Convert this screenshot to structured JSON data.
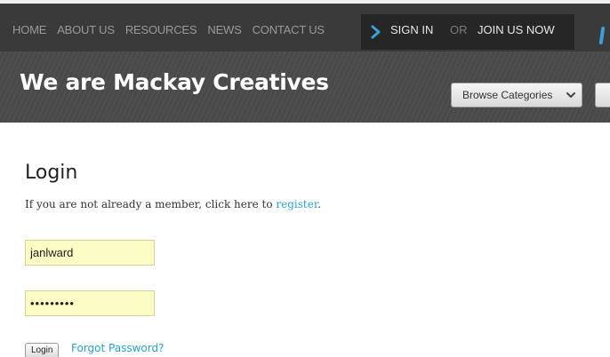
{
  "nav": {
    "links": [
      {
        "label": "HOME"
      },
      {
        "label": "ABOUT US"
      },
      {
        "label": "RESOURCES"
      },
      {
        "label": "NEWS"
      },
      {
        "label": "CONTACT US"
      }
    ],
    "signin_label": "SIGN IN",
    "or_label": "OR",
    "join_label": "JOIN US NOW"
  },
  "banner": {
    "title": "We are Mackay Creatives",
    "browse_label": "Browse Categories"
  },
  "login": {
    "title": "Login",
    "intro_text": "If you are not already a member, click here to ",
    "register_link": "register",
    "intro_end": ".",
    "username_value": "janlward",
    "password_value": "•••••••••",
    "login_button": "Login",
    "forgot_link": "Forgot Password?"
  },
  "colors": {
    "nav_bg": "#3a3a3a",
    "banner_bg": "#4b4b4b",
    "accent": "#2aa0d4",
    "field_bg": "#fbfbc4"
  }
}
